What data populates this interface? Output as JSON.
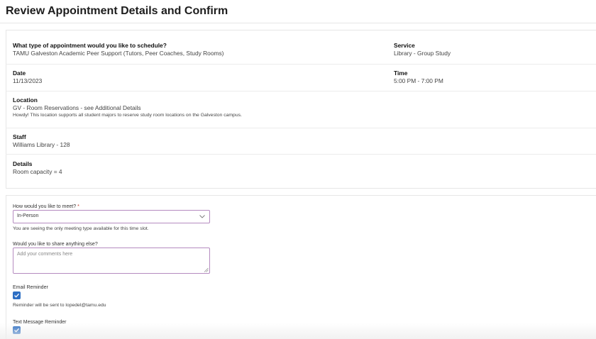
{
  "page": {
    "title": "Review Appointment Details and Confirm"
  },
  "summary": {
    "appointment_type": {
      "label": "What type of appointment would you like to schedule?",
      "value": "TAMU Galveston Academic Peer Support (Tutors, Peer Coaches, Study Rooms)"
    },
    "service": {
      "label": "Service",
      "value": "Library - Group Study"
    },
    "date": {
      "label": "Date",
      "value": "11/13/2023"
    },
    "time": {
      "label": "Time",
      "value": "5:00 PM - 7:00 PM"
    },
    "location": {
      "label": "Location",
      "value": "GV - Room Reservations - see Additional Details",
      "note": "Howdy! This location supports all student majors to reserve study room locations on the Galveston campus."
    },
    "staff": {
      "label": "Staff",
      "value": "Williams Library - 128"
    },
    "details": {
      "label": "Details",
      "value": "Room capacity = 4"
    }
  },
  "form": {
    "meeting_type": {
      "label": "How would you like to meet?",
      "required_mark": "*",
      "selected": "In-Person",
      "help": "You are seeing the only meeting type available for this time slot."
    },
    "comments": {
      "label": "Would you like to share anything else?",
      "placeholder": "Add your comments here"
    },
    "email_reminder": {
      "label": "Email Reminder",
      "checked": true,
      "help": "Reminder will be sent to lopedel@tamu.edu"
    },
    "text_reminder": {
      "label": "Text Message Reminder",
      "checked": true
    }
  },
  "colors": {
    "input_border": "#b58bc0",
    "checkbox": "#2d6fc4",
    "required": "#c0392b"
  }
}
